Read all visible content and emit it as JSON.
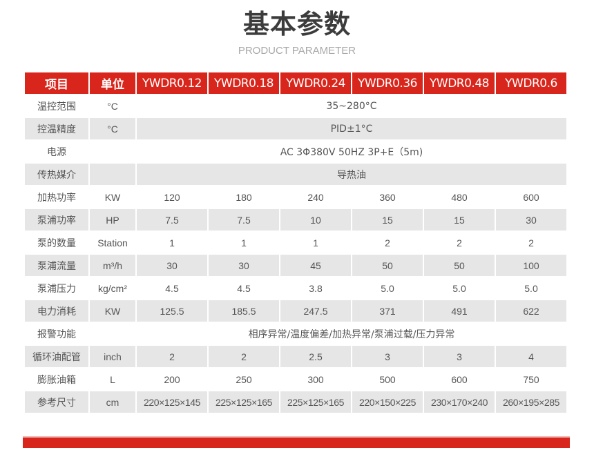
{
  "header": {
    "title": "基本参数",
    "subtitle": "PRODUCT PARAMETER"
  },
  "colors": {
    "accent": "#d9261c",
    "row_gray": "#e6e6e6",
    "title_text": "#3c3c3c",
    "subtitle_text": "#a8a8a8"
  },
  "table": {
    "headers": {
      "item": "项目",
      "unit": "单位",
      "models": [
        "YWDR0.12",
        "YWDR0.18",
        "YWDR0.24",
        "YWDR0.36",
        "YWDR0.48",
        "YWDR0.6"
      ]
    },
    "rows": {
      "temp_range": {
        "label": "温控范围",
        "unit": "°C",
        "value": "35~280°C"
      },
      "temp_precision": {
        "label": "控温精度",
        "unit": "°C",
        "value": "PID±1°C"
      },
      "power_supply": {
        "label": "电源",
        "unit": "",
        "value": "AC 3Φ380V 50HZ  3P+E（5m)"
      },
      "medium": {
        "label": "传热媒介",
        "unit": "",
        "value": "导热油"
      },
      "heating_power": {
        "label": "加热功率",
        "unit": "KW",
        "values": [
          "120",
          "180",
          "240",
          "360",
          "480",
          "600"
        ]
      },
      "pump_power": {
        "label": "泵浦功率",
        "unit": "HP",
        "values": [
          "7.5",
          "7.5",
          "10",
          "15",
          "15",
          "30"
        ]
      },
      "pump_count": {
        "label": "泵的数量",
        "unit": "Station",
        "values": [
          "1",
          "1",
          "1",
          "2",
          "2",
          "2"
        ]
      },
      "pump_flow": {
        "label": "泵浦流量",
        "unit": "m³/h",
        "values": [
          "30",
          "30",
          "45",
          "50",
          "50",
          "100"
        ]
      },
      "pump_pressure": {
        "label": "泵浦压力",
        "unit": "kg/cm²",
        "values": [
          "4.5",
          "4.5",
          "3.8",
          "5.0",
          "5.0",
          "5.0"
        ]
      },
      "power_consumption": {
        "label": "电力消耗",
        "unit": "KW",
        "values": [
          "125.5",
          "185.5",
          "247.5",
          "371",
          "491",
          "622"
        ]
      },
      "alarm": {
        "label": "报警功能",
        "unit": "",
        "value": "相序异常/温度偏差/加热异常/泵浦过载/压力异常"
      },
      "oil_pipe": {
        "label": "循环油配管",
        "unit": "inch",
        "values": [
          "2",
          "2",
          "2.5",
          "3",
          "3",
          "4"
        ]
      },
      "expansion_tank": {
        "label": "膨胀油箱",
        "unit": "L",
        "values": [
          "200",
          "250",
          "300",
          "500",
          "600",
          "750"
        ]
      },
      "dimensions": {
        "label": "参考尺寸",
        "unit": "cm",
        "values": [
          "220×125×145",
          "225×125×165",
          "225×125×165",
          "220×150×225",
          "230×170×240",
          "260×195×285"
        ]
      }
    }
  }
}
